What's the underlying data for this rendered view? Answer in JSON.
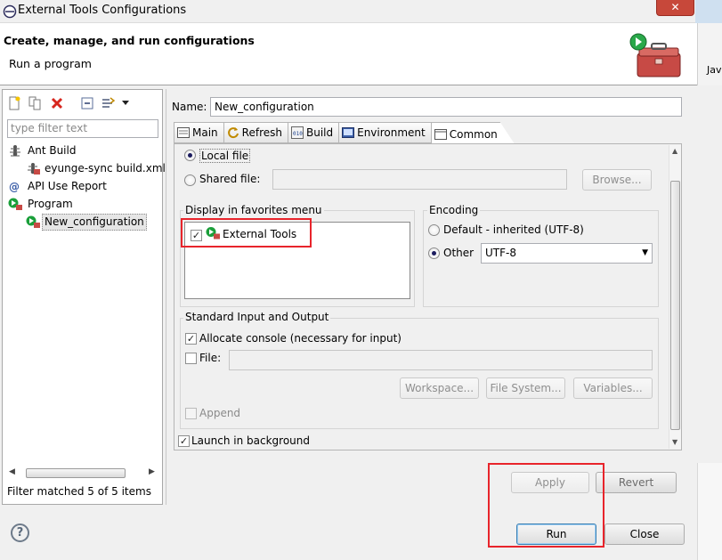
{
  "window": {
    "title": "External Tools Configurations",
    "close_glyph": "✕"
  },
  "header": {
    "title": "Create, manage, and run configurations",
    "subtitle": "Run a program",
    "right_tab_fragment": "Jav"
  },
  "left": {
    "filter_placeholder": "type filter text",
    "tree": [
      {
        "label": "Ant Build",
        "icon": "ant-icon",
        "level": 0
      },
      {
        "label": "eyunge-sync build.xml",
        "icon": "ant-config-icon",
        "level": 1
      },
      {
        "label": "API Use Report",
        "icon": "api-report-icon",
        "level": 0
      },
      {
        "label": "Program",
        "icon": "program-icon",
        "level": 0
      },
      {
        "label": "New_configuration",
        "icon": "program-config-icon",
        "level": 1,
        "selected": true
      }
    ],
    "status": "Filter matched 5 of 5 items"
  },
  "config": {
    "name_label": "Name:",
    "name_value": "New_configuration",
    "tabs": [
      "Main",
      "Refresh",
      "Build",
      "Environment",
      "Common"
    ],
    "active_tab": "Common",
    "save_as": {
      "local_label": "Local file",
      "shared_label": "Shared file:",
      "browse_label": "Browse..."
    },
    "favorites": {
      "title": "Display in favorites menu",
      "items": [
        {
          "label": "External Tools",
          "checked": true
        }
      ]
    },
    "encoding": {
      "title": "Encoding",
      "default_label": "Default - inherited (UTF-8)",
      "other_label": "Other",
      "other_value": "UTF-8",
      "selected": "Other"
    },
    "stdio": {
      "title": "Standard Input and Output",
      "allocate_label": "Allocate console (necessary for input)",
      "file_label": "File:",
      "workspace_label": "Workspace...",
      "filesystem_label": "File System...",
      "variables_label": "Variables...",
      "append_label": "Append"
    },
    "launch_background_label": "Launch in background",
    "apply_label": "Apply",
    "revert_label": "Revert"
  },
  "footer": {
    "run_label": "Run",
    "close_label": "Close",
    "help_glyph": "?"
  },
  "colors": {
    "highlight_red": "#e8242b",
    "accent_green": "#1a9f3a"
  }
}
